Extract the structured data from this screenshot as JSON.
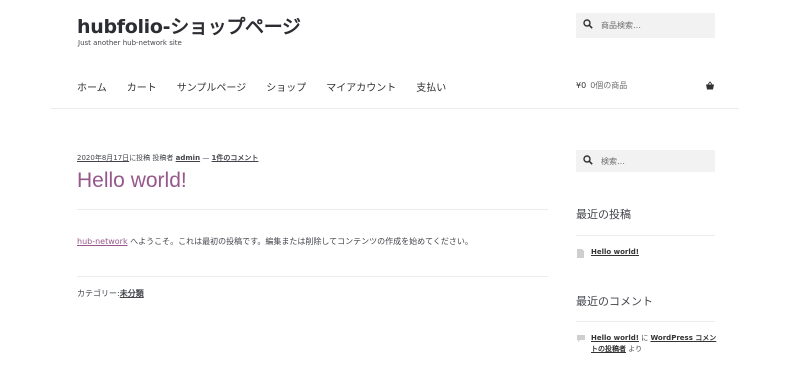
{
  "site": {
    "title": "hubfolio-ショップページ",
    "description": "Just another hub-network site"
  },
  "header_search": {
    "placeholder": "商品検索…"
  },
  "nav": [
    "ホーム",
    "カート",
    "サンプルページ",
    "ショップ",
    "マイアカウント",
    "支払い"
  ],
  "cart": {
    "amount": "¥0",
    "count_label": "0個の商品"
  },
  "post": {
    "meta_date": "2020年8月17日",
    "meta_posted": "に投稿",
    "meta_by": "投稿者",
    "meta_author": "admin",
    "meta_sep": "—",
    "meta_comments": "1件のコメント",
    "title": "Hello world!",
    "body_link": "hub-network",
    "body_text": "へようこそ。これは最初の投稿です。編集または削除してコンテンツの作成を始めてください。",
    "category_label": "カテゴリー:",
    "category_value": "未分類"
  },
  "sidebar": {
    "search_placeholder": "検索…",
    "recent_posts_title": "最近の投稿",
    "recent_posts": [
      "Hello world!"
    ],
    "recent_comments_title": "最近のコメント",
    "comment": {
      "post": "Hello world!",
      "on": "に",
      "author": "WordPress コメントの投稿者",
      "suffix": "より"
    }
  },
  "colors": {
    "accent": "#96588a",
    "text": "#43454b",
    "search_bg": "#f2f2f2"
  },
  "icons": {
    "search": "search-icon",
    "cart": "basket-icon",
    "post": "document-icon",
    "comment": "comment-icon"
  }
}
